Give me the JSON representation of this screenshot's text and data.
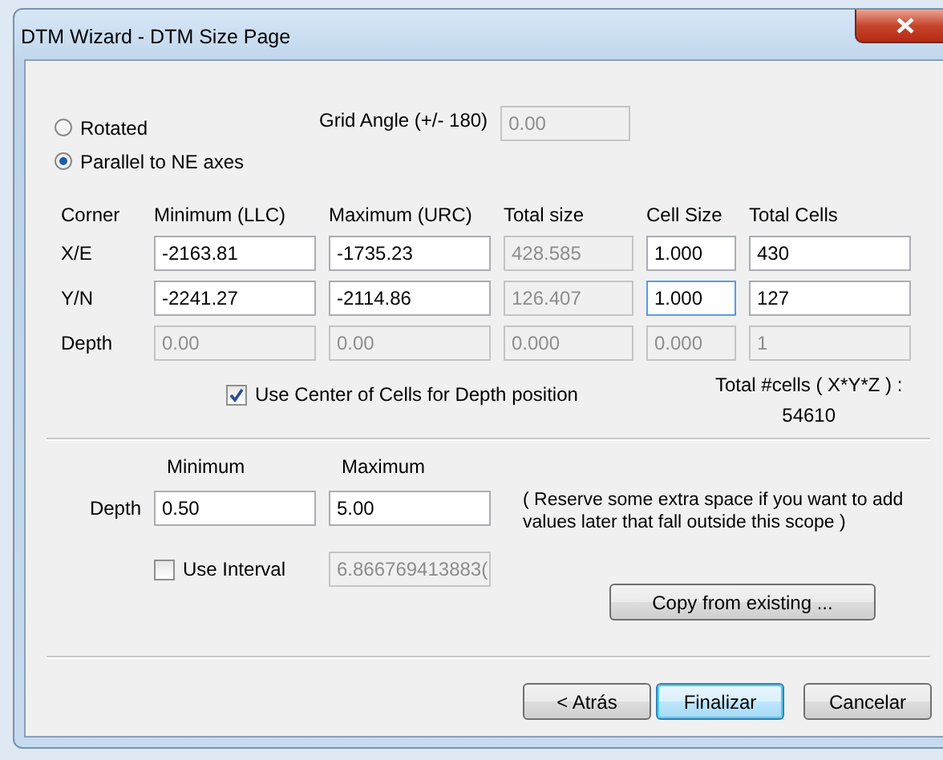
{
  "window": {
    "title": "DTM Wizard - DTM Size Page"
  },
  "orientation": [
    {
      "label": "Rotated",
      "selected": false
    },
    {
      "label": "Parallel to NE axes",
      "selected": true
    }
  ],
  "grid_angle": {
    "label": "Grid Angle (+/- 180)",
    "value": "0.00",
    "disabled": true
  },
  "table": {
    "columns": [
      "Corner",
      "Minimum (LLC)",
      "Maximum (URC)",
      "Total size",
      "Cell Size",
      "Total Cells"
    ],
    "rows": [
      {
        "cells": [
          {
            "kind": "label",
            "value": "X/E"
          },
          {
            "kind": "field",
            "value": "-2163.81",
            "disabled": false,
            "focused": false
          },
          {
            "kind": "field",
            "value": "-1735.23",
            "disabled": false,
            "focused": false
          },
          {
            "kind": "field",
            "value": "428.585",
            "disabled": true,
            "focused": false
          },
          {
            "kind": "field",
            "value": "1.000",
            "disabled": false,
            "focused": false
          },
          {
            "kind": "field",
            "value": "430",
            "disabled": false,
            "focused": false
          }
        ]
      },
      {
        "cells": [
          {
            "kind": "label",
            "value": "Y/N"
          },
          {
            "kind": "field",
            "value": "-2241.27",
            "disabled": false,
            "focused": false
          },
          {
            "kind": "field",
            "value": "-2114.86",
            "disabled": false,
            "focused": false
          },
          {
            "kind": "field",
            "value": "126.407",
            "disabled": true,
            "focused": false
          },
          {
            "kind": "field",
            "value": "1.000",
            "disabled": false,
            "focused": true
          },
          {
            "kind": "field",
            "value": "127",
            "disabled": false,
            "focused": false
          }
        ]
      },
      {
        "cells": [
          {
            "kind": "label",
            "value": "Depth"
          },
          {
            "kind": "field",
            "value": "0.00",
            "disabled": true,
            "focused": false
          },
          {
            "kind": "field",
            "value": "0.00",
            "disabled": true,
            "focused": false
          },
          {
            "kind": "field",
            "value": "0.000",
            "disabled": true,
            "focused": false
          },
          {
            "kind": "field",
            "value": "0.000",
            "disabled": true,
            "focused": false
          },
          {
            "kind": "field",
            "value": "1",
            "disabled": true,
            "focused": false
          }
        ]
      }
    ]
  },
  "center_checkbox": {
    "label": "Use Center of Cells for Depth position",
    "checked": true
  },
  "total_cells": {
    "label": "Total #cells ( X*Y*Z ) :",
    "value": "54610"
  },
  "depth_range": {
    "columns": [
      "Minimum",
      "Maximum"
    ],
    "label": "Depth",
    "minimum": "0.50",
    "maximum": "5.00",
    "note": "( Reserve some extra space if you want to add values later that fall outside this scope )"
  },
  "interval": {
    "label": "Use Interval",
    "checked": false,
    "value": "6.866769413883(",
    "disabled": true
  },
  "copy_button": "Copy from existing ...",
  "buttons": [
    {
      "label": "< Atrás",
      "default": false
    },
    {
      "label": "Finalizar",
      "default": true
    },
    {
      "label": "Cancelar",
      "default": false
    }
  ]
}
